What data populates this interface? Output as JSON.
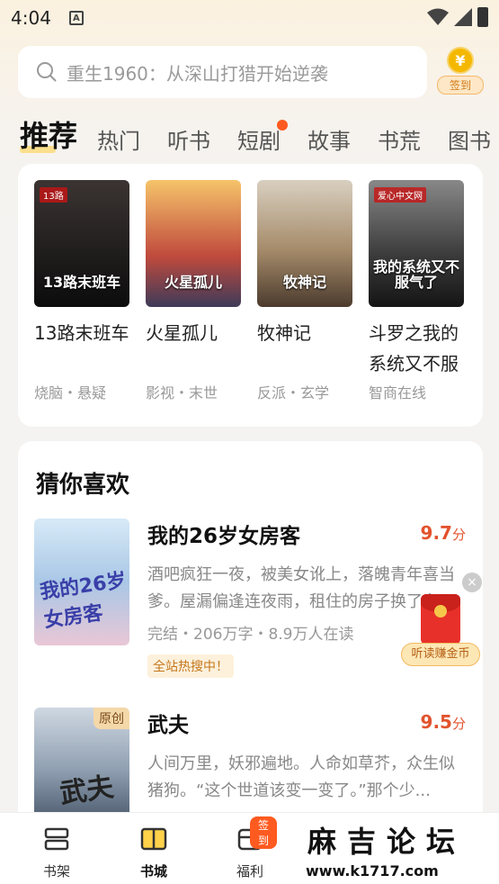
{
  "status_bar": {
    "time": "4:04",
    "notification_icon": "A"
  },
  "search": {
    "placeholder": "重生1960：从深山打猎开始逆袭",
    "checkin_label": "签到",
    "coin_symbol": "¥"
  },
  "tabs": [
    {
      "label": "推荐",
      "active": true
    },
    {
      "label": "热门"
    },
    {
      "label": "听书"
    },
    {
      "label": "短剧",
      "dot": true
    },
    {
      "label": "故事"
    },
    {
      "label": "书荒"
    },
    {
      "label": "图书"
    }
  ],
  "recommend_books": [
    {
      "name": "13路末班车",
      "tags": "烧脑・悬疑",
      "cover_text": "13路末班车",
      "cover_badge": "13路"
    },
    {
      "name": "火星孤儿",
      "tags": "影视・末世",
      "cover_text": "火星孤儿"
    },
    {
      "name": "牧神记",
      "tags": "反派・玄学",
      "cover_text": "牧神记"
    },
    {
      "name": "斗罗之我的系统又不服",
      "tags": "智商在线",
      "cover_text": "我的系统又不服气了",
      "cover_badge": "爱心中文网"
    }
  ],
  "guess_section": {
    "title": "猜你喜欢",
    "items": [
      {
        "name": "我的26岁女房客",
        "score": "9.7",
        "score_unit": "分",
        "desc": "酒吧疯狂一夜，被美女讹上，落魄青年喜当爹。屋漏偏逢连夜雨，租住的房子换了主",
        "meta": "完结・206万字・8.9万人在读",
        "badge": "全站热搜中！",
        "cover_text": "我的26岁女房客"
      },
      {
        "name": "武夫",
        "score": "9.5",
        "score_unit": "分",
        "desc": "人间万里，妖邪遍地。人命如草芥，众生似猪狗。“这个世道该变一变了。”那个少...",
        "cover_text": "武夫",
        "cover_badge": "原创"
      }
    ]
  },
  "floating": {
    "label": "听读赚金币",
    "close": "×"
  },
  "bottom_nav": [
    {
      "label": "书架",
      "icon": "bookshelf-icon"
    },
    {
      "label": "书城",
      "icon": "bookstore-icon",
      "active": true
    },
    {
      "label": "福利",
      "icon": "welfare-icon",
      "badge": "签到"
    }
  ],
  "watermark": {
    "title": "麻吉论坛",
    "url": "www.k1717.com"
  }
}
